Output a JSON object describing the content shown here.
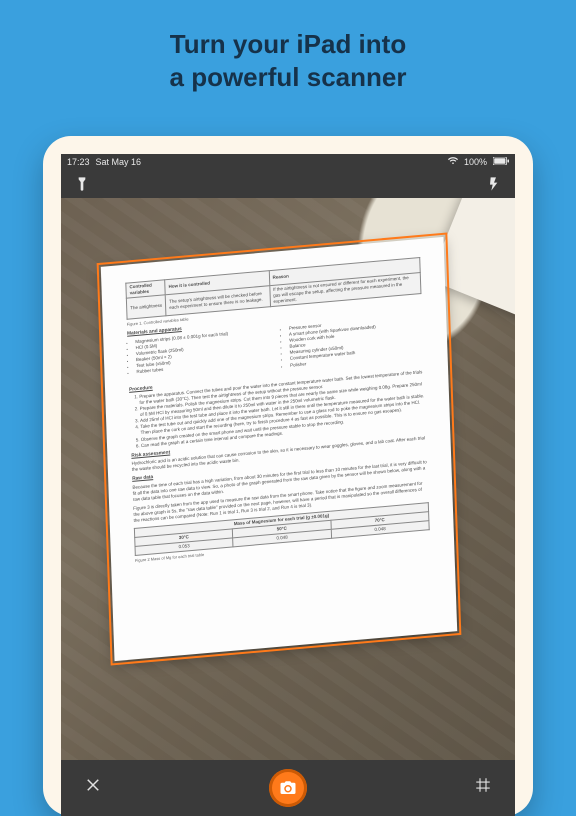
{
  "headline": {
    "line1": "Turn your iPad into",
    "line2": "a powerful scanner"
  },
  "statusbar": {
    "time": "17:23",
    "date": "Sat May 16",
    "battery": "100%"
  },
  "document": {
    "table1": {
      "headers": [
        "Controlled variables",
        "How it is controlled",
        "Reason"
      ],
      "row": [
        "The airtightness",
        "The setup's airtightness will be checked before each experiment to ensure there is no leakage.",
        "If the airtightness is not ensured or different for each experiment, the gas will escape the setup, affecting the pressure measured in the experiment."
      ],
      "caption": "Figure 1. Controlled variables table"
    },
    "materials_heading": "Materials and apparatus",
    "materials_left": [
      "Magnesium strips (0.08 ± 0.001g for each trial)",
      "HCl (0.5M)",
      "Volumetric flask (250ml)",
      "Beaker (50ml × 2)",
      "Test tube (x50ml)",
      "Rubber tubes"
    ],
    "materials_right": [
      "Pressure sensor",
      "A smart phone (with Sparkvue downloaded)",
      "Wooden cork with hole",
      "Balance",
      "Measuring cylinder (x50ml)",
      "Constant temperature water bath",
      "Polisher"
    ],
    "procedure_heading": "Procedure",
    "procedure": [
      "Prepare the apparatus. Connect the tubes and pour the water into the constant temperature water bath. Set the lowest temperature of the trials for the water bath (30°C). Then test the airtightness of the setup without the pressure sensor.",
      "Prepare the materials. Polish the magnesium strips. Cut them into 9 pieces that are nearly the same size while weighing 0.08g. Prepare 250ml of 0.5M HCl by measuring 50ml and then dilute it to 250ml with water in the 250ml volumetric flask.",
      "Add 25ml of HCl into the test tube and place it into the water bath. Let it still in there until the temperature measured for the water bath is stable.",
      "Take the test tube out and quickly add one of the magnesium strips. Remember to use a glass rod to poke the magnesium strips into the HCl. Then place the cork on and start the recording (here, try to finish procedure 4 as fast as possible. This is to ensure no gas escapes).",
      "Observe the graph created on the smart phone and wait until the pressure stable to stop the recording.",
      "Can read the graph at a certain time interval and compare the readings."
    ],
    "risk_heading": "Risk assessment",
    "risk": "Hydrochloric acid is an acidic solution that can cause corrosion to the skin, so it is necessary to wear goggles, gloves, and a lab coat. After each trial the waste should be recycled into the acidic waste bin.",
    "raw_heading": "Raw data",
    "raw": "Because the time of each trial has a high variation, from about 30 minutes for the first trial to less than 10 minutes for the last trial, it is very difficult to fit all the data into one raw data to view. So, a photo of the graph generated from the raw data given by the sensor will be shown below, along with a raw data table that focuses on the data within.",
    "raw2": "Figure 3 is directly taken from the app used to measure the raw data from the smart phone. Take notice that the figure and zoom measurement for the above graph is 5s, the \"raw data table\" provided on the next page, however, will have a period that is manipulated so the overall differences of the reactions can be compared (Note: Run 1 is trial 1, Run 3 is trial 2, and Run 4 is trial 3).",
    "table2": {
      "title": "Mass of Magnesium for each trial (g ±0.001g)",
      "headers": [
        "30°C",
        "50°C",
        "70°C"
      ],
      "row": [
        "0.053",
        "0.048",
        "0.048"
      ],
      "caption": "Figure 2 Mass of Mg for each trial table"
    }
  }
}
